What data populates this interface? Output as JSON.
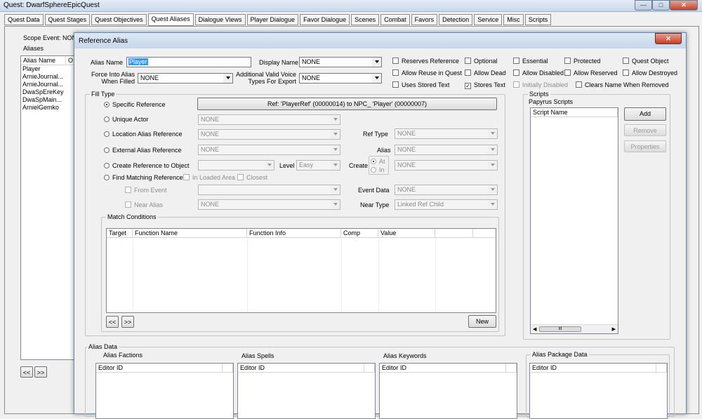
{
  "window": {
    "title": "Quest: DwarfSphereEpicQuest"
  },
  "tabs": [
    "Quest Data",
    "Quest Stages",
    "Quest Objectives",
    "Quest Aliases",
    "Dialogue Views",
    "Player Dialogue",
    "Favor Dialogue",
    "Scenes",
    "Combat",
    "Favors",
    "Detection",
    "Service",
    "Misc",
    "Scripts"
  ],
  "active_tab": "Quest Aliases",
  "left": {
    "scope_event_label": "Scope Event: NON",
    "aliases_label": "Aliases",
    "col_alias_name": "Alias Name",
    "col_o": "O",
    "aliases": [
      "Player",
      "ArnieJournal...",
      "ArnieJournal...",
      "DwaSpEreKey",
      "DwaSpMain...",
      "ArnielGemko"
    ],
    "prev": "<<",
    "next": ">>"
  },
  "dialog": {
    "title": "Reference Alias",
    "alias_name_label": "Alias Name",
    "alias_name": "Player",
    "display_name_label": "Display Name",
    "display_name": "NONE",
    "force_label": "Force Into Alias When Filled",
    "force_value": "NONE",
    "voice_label": "Additional Valid Voice Types For Export",
    "voice_value": "NONE",
    "checks": {
      "reserves_reference": "Reserves Reference",
      "optional": "Optional",
      "essential": "Essential",
      "protected": "Protected",
      "quest_object": "Quest Object",
      "allow_reuse": "Allow Reuse in Quest",
      "allow_dead": "Allow Dead",
      "allow_disabled": "Allow Disabled",
      "allow_reserved": "Allow Reserved",
      "allow_destroyed": "Allow Destroyed",
      "uses_stored_text": "Uses Stored Text",
      "stores_text": "Stores Text",
      "initially_disabled": "Initially Disabled",
      "clears_name": "Clears Name When Removed"
    },
    "fill_type": {
      "label": "Fill Type",
      "specific_reference": "Specific Reference",
      "ref_button": "Ref: 'PlayerRef' (00000014) to NPC_ 'Player' (00000007)",
      "unique_actor": "Unique Actor",
      "unique_actor_value": "NONE",
      "location_alias": "Location Alias Reference",
      "location_alias_value": "NONE",
      "ref_type_label": "Ref Type",
      "ref_type_value": "NONE",
      "external_alias": "External Alias Reference",
      "external_alias_value": "NONE",
      "alias_label": "Alias",
      "alias_value": "NONE",
      "create_ref": "Create Reference to Object",
      "create_ref_value": "",
      "level_label": "Level",
      "level_value": "Easy",
      "create_label": "Create",
      "at_label": "At",
      "in_label": "In",
      "create_value": "NONE",
      "find_matching": "Find Matching Reference",
      "in_loaded_area": "In Loaded Area",
      "closest": "Closest",
      "from_event": "From Event",
      "from_event_value": "",
      "event_data_label": "Event Data",
      "event_data_value": "NONE",
      "near_alias": "Near Alias",
      "near_alias_value": "NONE",
      "near_type_label": "Near Type",
      "near_type_value": "Linked Ref Child",
      "match_conditions": "Match Conditions",
      "cond_cols": [
        "Target",
        "Function Name",
        "Function Info",
        "Comp",
        "Value"
      ],
      "prev": "<<",
      "next": ">>",
      "new_button": "New"
    },
    "scripts": {
      "label": "Scripts",
      "papyrus": "Papyrus Scripts",
      "col": "Script Name",
      "add": "Add",
      "remove": "Remove",
      "properties": "Properties",
      "scroll_thumb": "III"
    },
    "alias_data": {
      "label": "Alias Data",
      "factions": "Alias Factions",
      "spells": "Alias Spells",
      "keywords": "Alias Keywords",
      "package": "Alias Package Data",
      "editor_id": "Editor ID"
    }
  }
}
